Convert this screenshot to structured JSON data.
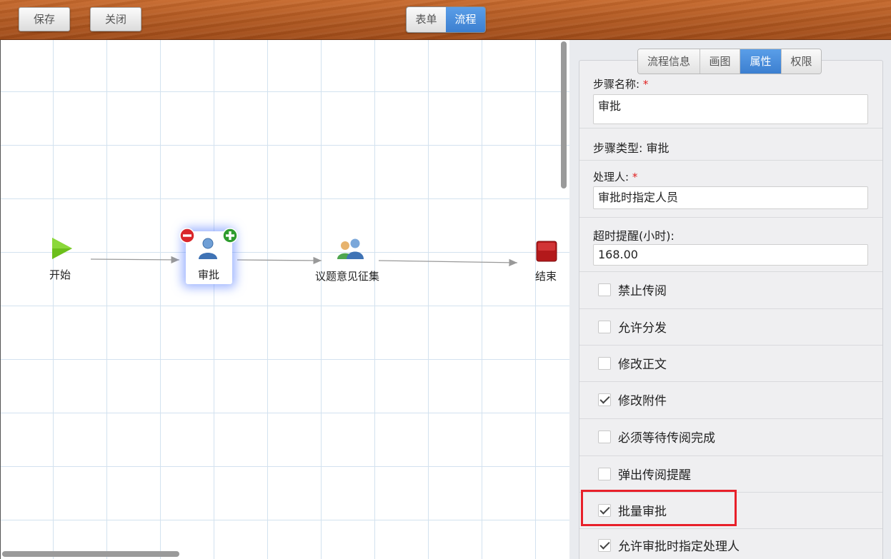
{
  "toolbar": {
    "save_label": "保存",
    "close_label": "关闭",
    "view_tabs": [
      {
        "label": "表单",
        "active": false
      },
      {
        "label": "流程",
        "active": true
      }
    ]
  },
  "flow": {
    "nodes": [
      {
        "label": "开始",
        "icon": "play-icon",
        "color": "#6cbf1b"
      },
      {
        "label": "审批",
        "icon": "user-icon",
        "selected": true
      },
      {
        "label": "议题意见征集",
        "icon": "users-icon"
      },
      {
        "label": "结束",
        "icon": "stop-icon",
        "color": "#b3191b"
      }
    ]
  },
  "panel": {
    "tabs": [
      {
        "label": "流程信息",
        "active": false
      },
      {
        "label": "画图",
        "active": false
      },
      {
        "label": "属性",
        "active": true
      },
      {
        "label": "权限",
        "active": false
      }
    ],
    "step_name_label": "步骤名称:",
    "step_name_value": "审批",
    "step_type_label": "步骤类型: 审批",
    "handler_label": "处理人:",
    "handler_value": "审批时指定人员",
    "timeout_label": "超时提醒(小时):",
    "timeout_value": "168.00",
    "required_mark": "*",
    "options": [
      {
        "label": "禁止传阅",
        "checked": false
      },
      {
        "label": "允许分发",
        "checked": false
      },
      {
        "label": "修改正文",
        "checked": false
      },
      {
        "label": "修改附件",
        "checked": true
      },
      {
        "label": "必须等待传阅完成",
        "checked": false
      },
      {
        "label": "弹出传阅提醒",
        "checked": false
      },
      {
        "label": "批量审批",
        "checked": true
      },
      {
        "label": "允许审批时指定处理人",
        "checked": true
      }
    ]
  },
  "colors": {
    "accent": "#3c7fd0",
    "highlight": "#e8202a"
  }
}
